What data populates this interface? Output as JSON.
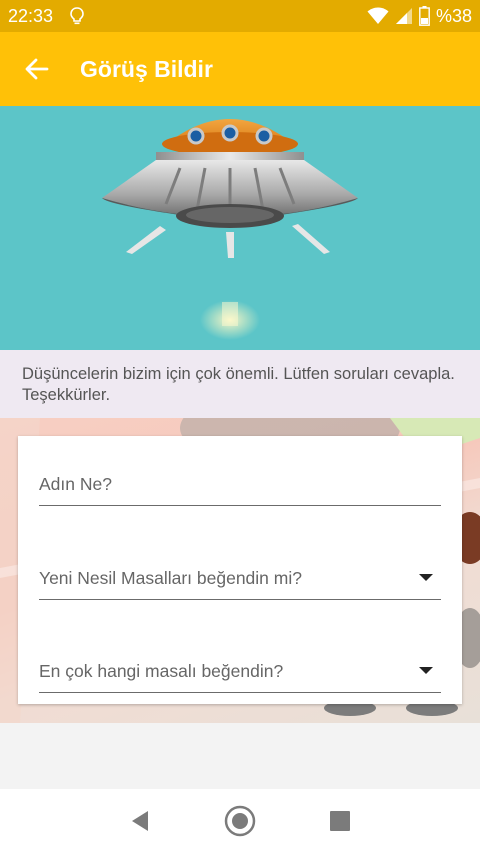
{
  "status_bar": {
    "time": "22:33",
    "battery": "%38",
    "icons": [
      "lightbulb-icon",
      "wifi-icon",
      "signal-icon",
      "battery-icon"
    ]
  },
  "app_bar": {
    "title": "Görüş Bildir",
    "back_icon": "arrow-left-icon"
  },
  "intro_text": "Düşüncelerin bizim için çok önemli. Lütfen soruları cevapla. Teşekkürler.",
  "form": {
    "name_placeholder": "Adın Ne?",
    "question1_label": "Yeni Nesil Masalları beğendin mi?",
    "question2_label": "En çok hangi masalı beğendin?"
  },
  "colors": {
    "status_bar": "#e3ab00",
    "app_bar": "#ffc107",
    "hero_bg": "#5cc5c8"
  }
}
